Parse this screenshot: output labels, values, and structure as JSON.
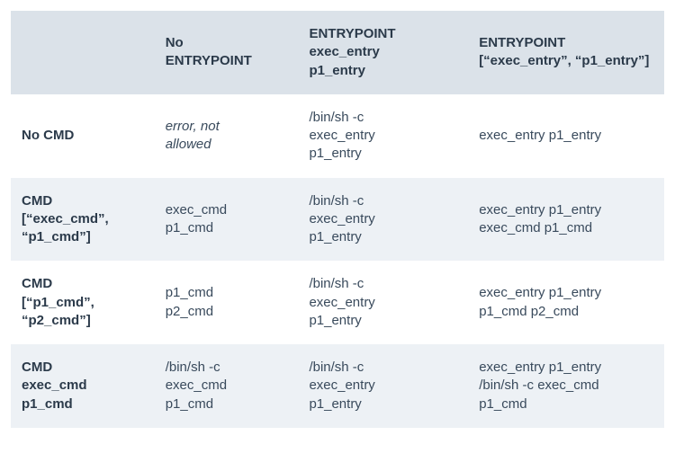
{
  "headers": {
    "col0": "",
    "col1_l1": "No",
    "col1_l2": "ENTRYPOINT",
    "col2_l1": "ENTRYPOINT",
    "col2_l2": "exec_entry",
    "col2_l3": "p1_entry",
    "col3_l1": "ENTRYPOINT",
    "col3_l2": "[“exec_entry”, “p1_entry”]"
  },
  "rows": {
    "r0": {
      "head_l1": "No CMD",
      "c1_l1": "error, not",
      "c1_l2": "allowed",
      "c2_l1": "/bin/sh -c",
      "c2_l2": "exec_entry",
      "c2_l3": "p1_entry",
      "c3_l1": "exec_entry p1_entry"
    },
    "r1": {
      "head_l1": "CMD",
      "head_l2": "[“exec_cmd”,",
      "head_l3": "“p1_cmd”]",
      "c1_l1": "exec_cmd",
      "c1_l2": "p1_cmd",
      "c2_l1": "/bin/sh -c",
      "c2_l2": "exec_entry",
      "c2_l3": "p1_entry",
      "c3_l1": "exec_entry p1_entry",
      "c3_l2": "exec_cmd p1_cmd"
    },
    "r2": {
      "head_l1": "CMD",
      "head_l2": "[“p1_cmd”,",
      "head_l3": "“p2_cmd”]",
      "c1_l1": "p1_cmd",
      "c1_l2": "p2_cmd",
      "c2_l1": "/bin/sh -c",
      "c2_l2": "exec_entry",
      "c2_l3": "p1_entry",
      "c3_l1": "exec_entry p1_entry",
      "c3_l2": "p1_cmd p2_cmd"
    },
    "r3": {
      "head_l1": "CMD",
      "head_l2": "exec_cmd",
      "head_l3": "p1_cmd",
      "c1_l1": "/bin/sh -c",
      "c1_l2": "exec_cmd",
      "c1_l3": "p1_cmd",
      "c2_l1": "/bin/sh -c",
      "c2_l2": "exec_entry",
      "c2_l3": "p1_entry",
      "c3_l1": "exec_entry p1_entry",
      "c3_l2": "/bin/sh -c exec_cmd",
      "c3_l3": "p1_cmd"
    }
  }
}
